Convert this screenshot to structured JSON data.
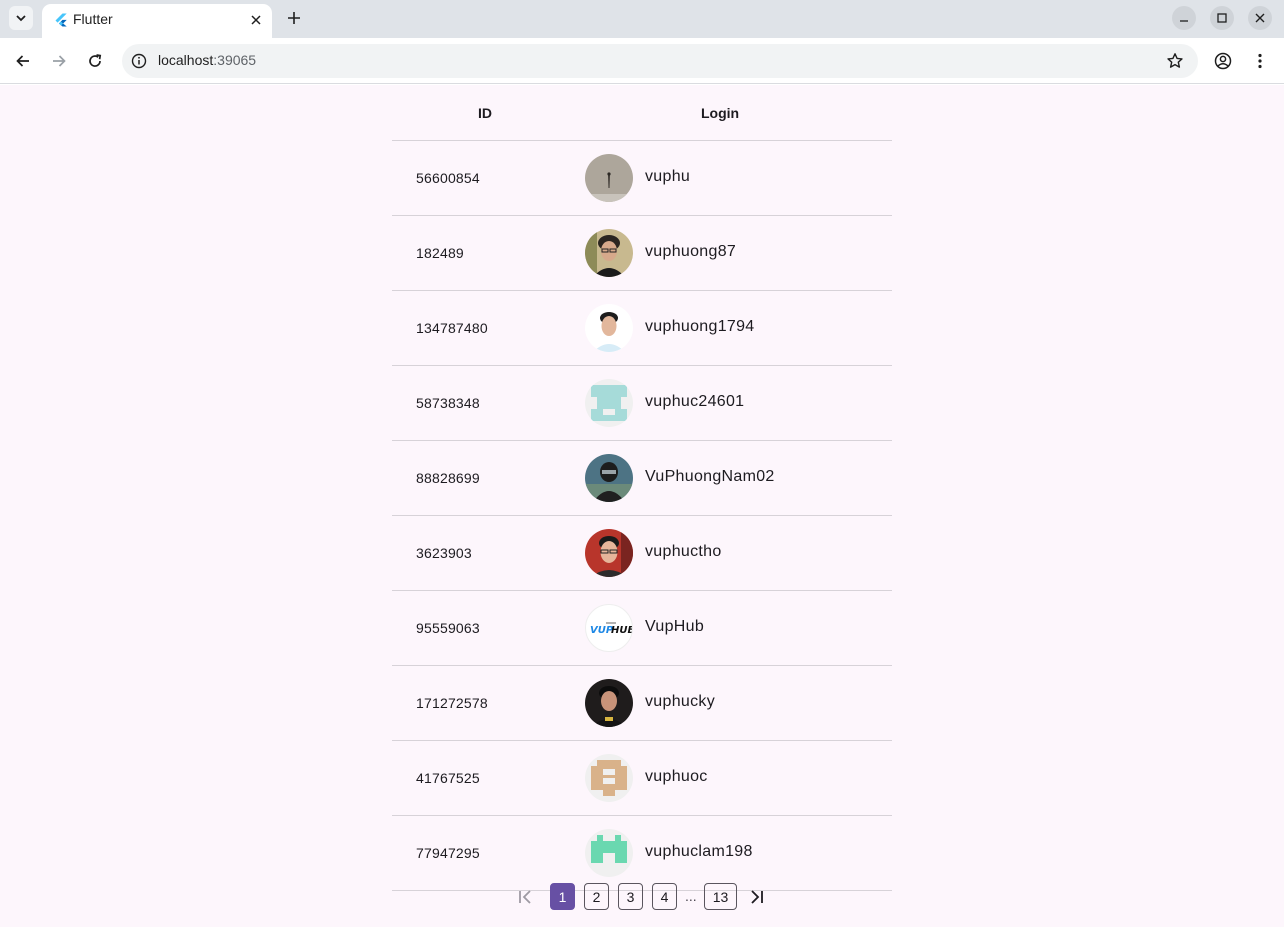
{
  "browser": {
    "tab_title": "Flutter",
    "url_host": "localhost",
    "url_port": ":39065"
  },
  "table": {
    "headers": {
      "id": "ID",
      "login": "Login"
    },
    "rows": [
      {
        "id": "56600854",
        "login": "vuphu",
        "avatar": "avatar-photo-sketch"
      },
      {
        "id": "182489",
        "login": "vuphuong87",
        "avatar": "avatar-photo-glasses"
      },
      {
        "id": "134787480",
        "login": "vuphuong1794",
        "avatar": "avatar-photo-portrait"
      },
      {
        "id": "58738348",
        "login": "vuphuc24601",
        "avatar": "avatar-identicon-teal"
      },
      {
        "id": "88828699",
        "login": "VuPhuongNam02",
        "avatar": "avatar-photo-masked"
      },
      {
        "id": "3623903",
        "login": "vuphuctho",
        "avatar": "avatar-photo-red"
      },
      {
        "id": "95559063",
        "login": "VupHub",
        "avatar": "avatar-logo-vuphub"
      },
      {
        "id": "171272578",
        "login": "vuphucky",
        "avatar": "avatar-photo-dark"
      },
      {
        "id": "41767525",
        "login": "vuphuoc",
        "avatar": "avatar-identicon-tan"
      },
      {
        "id": "77947295",
        "login": "vuphuclam198",
        "avatar": "avatar-identicon-green"
      }
    ]
  },
  "pagination": {
    "pages": [
      "1",
      "2",
      "3",
      "4"
    ],
    "ellipsis": "...",
    "last_page": "13",
    "current": "1"
  },
  "logo_text": "VUPHUB",
  "colors": {
    "accent": "#6750a4",
    "page_bg": "#fdf6fc"
  }
}
